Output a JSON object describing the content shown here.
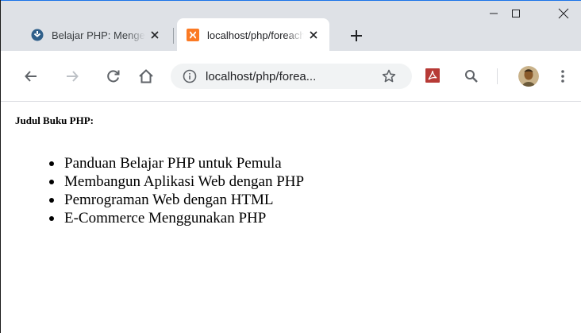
{
  "browser": {
    "tabs": [
      {
        "title": "Belajar PHP: Mengenal Perulangan Foreach",
        "favicon": "site-favicon",
        "active": false
      },
      {
        "title": "localhost/php/foreach.php",
        "favicon": "xampp-favicon",
        "active": true
      }
    ],
    "new_tab_icon": "plus-icon",
    "window_controls": [
      "minimize-icon",
      "maximize-icon",
      "close-icon"
    ],
    "address": "localhost/php/forea...",
    "address_icon": "info-icon",
    "toolbar_icons": [
      "back-arrow-icon",
      "forward-arrow-icon",
      "reload-icon",
      "home-icon",
      "star-icon",
      "pdf-extension-icon",
      "search-icon",
      "profile-avatar",
      "kebab-menu-icon"
    ],
    "accent_color": "#1a73e8",
    "tabstrip_color": "#dee1e6"
  },
  "page": {
    "heading": "Judul Buku PHP:",
    "books": [
      "Panduan Belajar PHP untuk Pemula",
      "Membangun Aplikasi Web dengan PHP",
      "Pemrograman Web dengan HTML",
      "E-Commerce Menggunakan PHP"
    ]
  }
}
